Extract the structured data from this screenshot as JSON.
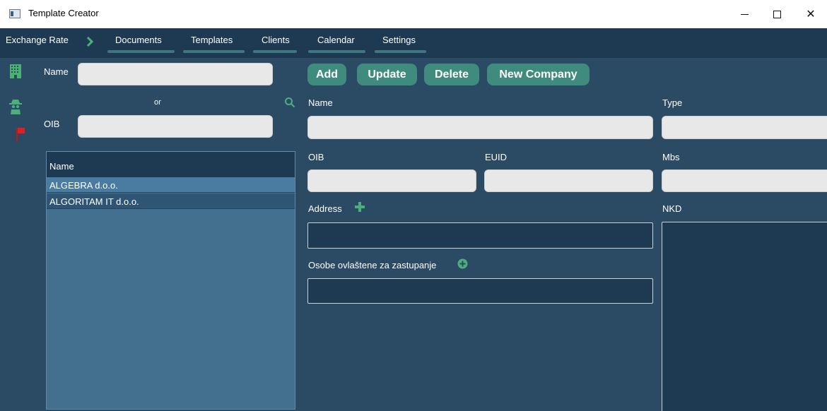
{
  "window": {
    "title": "Template Creator"
  },
  "nav": {
    "exchange_rate": "Exchange Rate",
    "items": [
      "Documents",
      "Templates",
      "Clients",
      "Calendar",
      "Settings"
    ]
  },
  "search": {
    "name_label": "Name",
    "or_label": "or",
    "oib_label": "OIB",
    "name_value": "",
    "oib_value": ""
  },
  "list": {
    "header": "Name",
    "rows": [
      "ALGEBRA d.o.o.",
      "ALGORITAM IT d.o.o."
    ],
    "selected_index": 0
  },
  "actions": {
    "add": "Add",
    "update": "Update",
    "delete": "Delete",
    "new_company": "New Company"
  },
  "form": {
    "name_label": "Name",
    "type_label": "Type",
    "oib_label": "OIB",
    "euid_label": "EUID",
    "mbs_label": "Mbs",
    "address_label": "Address",
    "nkd_label": "NKD",
    "persons_label": "Osobe ovlaštene za zastupanje"
  },
  "colors": {
    "background": "#2b4a64",
    "nav": "#1e3a52",
    "accent_button": "#3f8c7f",
    "icon_green": "#4caf7a",
    "flag_red": "#e02020"
  }
}
